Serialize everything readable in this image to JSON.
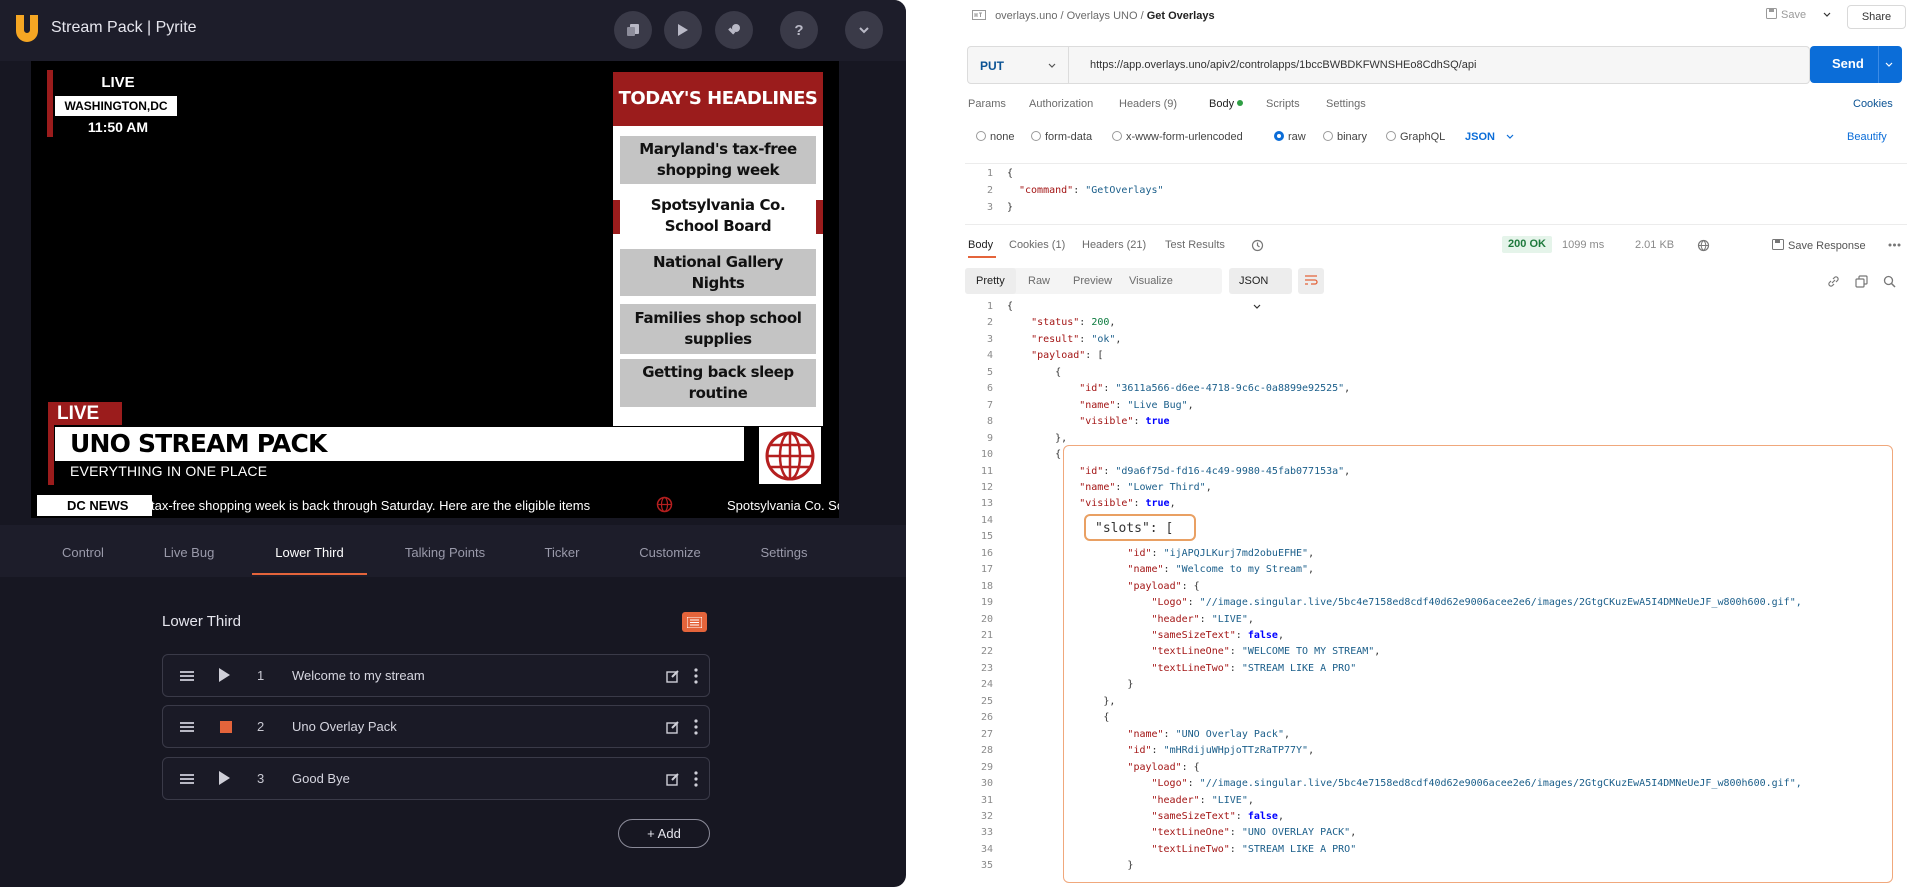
{
  "app": {
    "title": "Stream Pack | Pyrite",
    "header_buttons": [
      "copy-icon",
      "play-icon",
      "key-icon",
      "help-icon",
      "chevron-down-icon"
    ],
    "help_glyph": "?"
  },
  "preview": {
    "live_bug": {
      "live": "LIVE",
      "location": "WASHINGTON,DC",
      "time": "11:50 AM"
    },
    "headlines": {
      "title": "TODAY'S HEADLINES",
      "items": [
        "Maryland's tax-free shopping week",
        "Spotsylvania Co. School Board",
        "National Gallery Nights",
        "Families shop school supplies",
        "Getting back sleep routine"
      ]
    },
    "lower_third": {
      "header": "LIVE",
      "line_one": "UNO STREAM PACK",
      "line_two": "EVERYTHING IN ONE PLACE"
    },
    "ticker": {
      "label": "DC NEWS",
      "text1": "tax-free shopping week is back through Saturday. Here are the eligible items",
      "text2": "Spotsylvania Co. Sc"
    }
  },
  "tabs": [
    "Control",
    "Live Bug",
    "Lower Third",
    "Talking Points",
    "Ticker",
    "Customize",
    "Settings"
  ],
  "active_tab": "Lower Third",
  "panel": {
    "heading": "Lower Third",
    "rows": [
      {
        "num": "1",
        "label": "Welcome to my stream",
        "state": "play"
      },
      {
        "num": "2",
        "label": "Uno Overlay Pack",
        "state": "stop"
      },
      {
        "num": "3",
        "label": "Good Bye",
        "state": "play"
      }
    ],
    "add_label": "Add",
    "add_plus": "+"
  },
  "postman": {
    "breadcrumb": {
      "root": "overlays.uno",
      "sep": "/",
      "mid": "Overlays UNO",
      "current": "Get Overlays"
    },
    "save": "Save",
    "share": "Share",
    "method": "PUT",
    "url": "https://app.overlays.uno/apiv2/controlapps/1bccBWBDKFWNSHEo8CdhSQ/api",
    "send": "Send",
    "request_tabs": [
      "Params",
      "Authorization",
      "Headers (9)",
      "Body",
      "Scripts",
      "Settings"
    ],
    "cookies": "Cookies",
    "body_types": [
      "none",
      "form-data",
      "x-www-form-urlencoded",
      "raw",
      "binary",
      "GraphQL"
    ],
    "selected_body_type": "raw",
    "raw_format": "JSON",
    "beautify": "Beautify",
    "request_body": {
      "l1": "{",
      "key": "\"command\"",
      "colon": ": ",
      "val": "\"GetOverlays\"",
      "l3": "}"
    },
    "response_tabs": [
      "Body",
      "Cookies (1)",
      "Headers (21)",
      "Test Results"
    ],
    "status": "200 OK",
    "time": "1099 ms",
    "size": "2.01 KB",
    "save_response": "Save Response",
    "format_tabs": [
      "Pretty",
      "Raw",
      "Preview",
      "Visualize"
    ],
    "format": "JSON",
    "accent": "#e4643b",
    "send_color": "#0b6dd8"
  },
  "response_lines": [
    "{",
    "    \"status\": 200,",
    "    \"result\": \"ok\",",
    "    \"payload\": [",
    "        {",
    "            \"id\": \"3611a566-d6ee-4718-9c6c-0a8899e92525\",",
    "            \"name\": \"Live Bug\",",
    "            \"visible\": true",
    "        },",
    "        {",
    "            \"id\": \"d9a6f75d-fd16-4c49-9980-45fab077153a\",",
    "            \"name\": \"Lower Third\",",
    "            \"visible\": true,",
    "",
    "",
    "                    \"id\": \"ijAPQJLKurj7md2obuEFHE\",",
    "                    \"name\": \"Welcome to my Stream\",",
    "                    \"payload\": {",
    "                        \"Logo\": \"//image.singular.live/5bc4e7158ed8cdf40d62e9006acee2e6/images/2GtgCKuzEwA5I4DMNeUeJF_w800h600.gif\",",
    "                        \"header\": \"LIVE\",",
    "                        \"sameSizeText\": false,",
    "                        \"textLineOne\": \"WELCOME TO MY STREAM\",",
    "                        \"textLineTwo\": \"STREAM LIKE A PRO\"",
    "                    }",
    "                },",
    "                {",
    "                    \"name\": \"UNO Overlay Pack\",",
    "                    \"id\": \"mHRdijuWHpjoTTzRaTP77Y\",",
    "                    \"payload\": {",
    "                        \"Logo\": \"//image.singular.live/5bc4e7158ed8cdf40d62e9006acee2e6/images/2GtgCKuzEwA5I4DMNeUeJF_w800h600.gif\",",
    "                        \"header\": \"LIVE\",",
    "                        \"sameSizeText\": false,",
    "                        \"textLineOne\": \"UNO OVERLAY PACK\",",
    "                        \"textLineTwo\": \"STREAM LIKE A PRO\"",
    "                    }"
  ],
  "slots_line": "\"slots\": ["
}
